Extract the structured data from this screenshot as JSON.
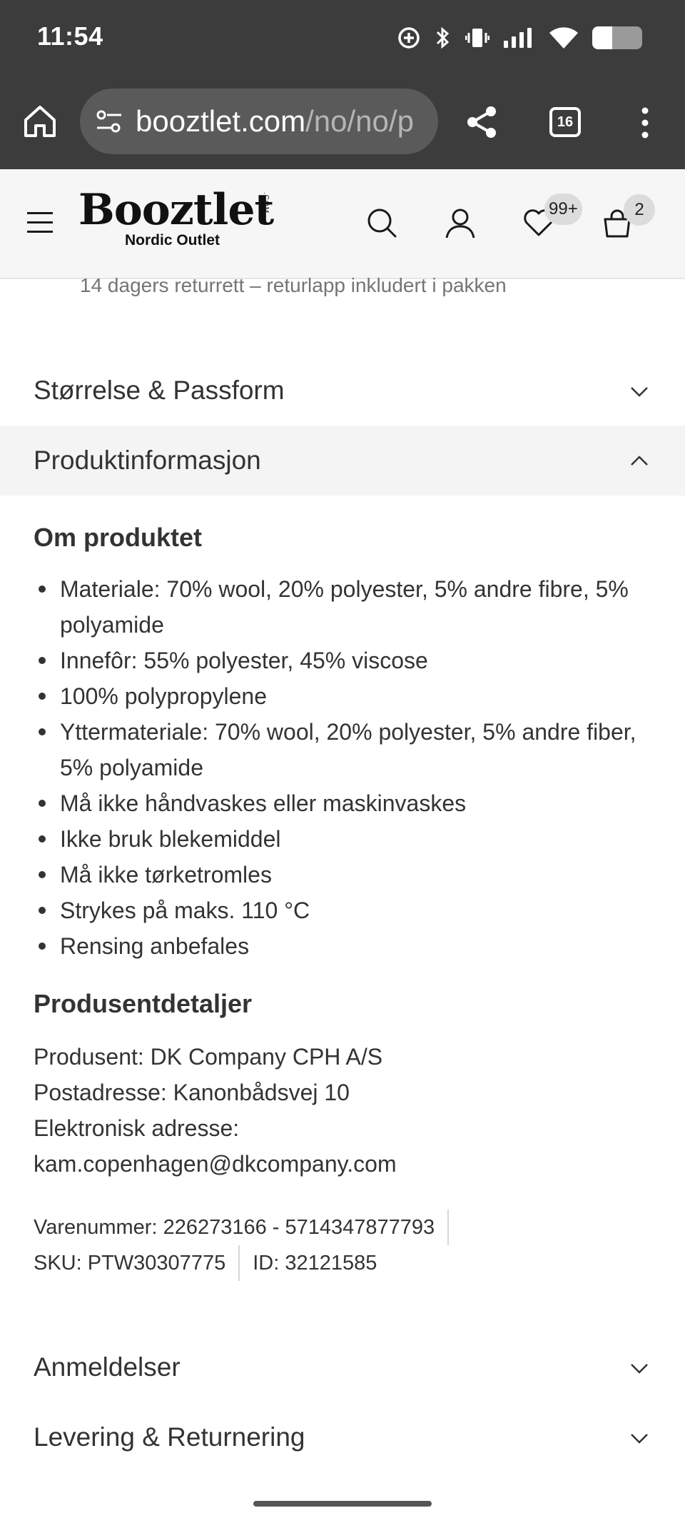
{
  "status_bar": {
    "time": "11:54",
    "battery_level": 0.4
  },
  "browser": {
    "url_host": "booztlet.com",
    "url_path": "/no/no/p",
    "tab_count": "16"
  },
  "site_header": {
    "logo_text": "Booztlet",
    "logo_com": ".COM",
    "logo_subtitle": "Nordic Outlet",
    "wishlist_badge": "99+",
    "cart_badge": "2"
  },
  "return_note": "14 dagers returrett – returlapp inkludert i pakken",
  "accordions": {
    "size_fit": "Størrelse & Passform",
    "product_info": "Produktinformasjon",
    "reviews": "Anmeldelser",
    "delivery_returns": "Levering & Returnering"
  },
  "product_info": {
    "about_title": "Om produktet",
    "bullets": [
      "Materiale: 70% wool, 20% polyester, 5% andre fibre, 5% polyamide",
      "Innefôr: 55% polyester, 45% viscose",
      "100% polypropylene",
      "Yttermateriale: 70% wool, 20% polyester, 5% andre fiber, 5% polyamide",
      "Må ikke håndvaskes eller maskinvaskes",
      "Ikke bruk blekemiddel",
      "Må ikke tørketromles",
      "Strykes på maks. 110 °C",
      "Rensing anbefales"
    ],
    "manufacturer_title": "Produsentdetaljer",
    "manufacturer_lines": [
      "Produsent: DK Company CPH A/S",
      "Postadresse: Kanonbådsvej 10",
      "Elektronisk adresse:",
      "kam.copenhagen@dkcompany.com"
    ],
    "item_number": "Varenummer: 226273166 - 5714347877793",
    "sku": "SKU: PTW30307775",
    "id": "ID: 32121585"
  },
  "icons": {
    "home": "home-icon",
    "site_settings": "tune-icon",
    "share": "share-icon",
    "tabs": "tabs-icon",
    "more": "more-vert-icon",
    "menu": "hamburger-icon",
    "search": "search-icon",
    "account": "user-icon",
    "wishlist": "heart-icon",
    "cart": "bag-icon",
    "expand": "chevron-down-icon",
    "collapse": "chevron-up-icon"
  }
}
